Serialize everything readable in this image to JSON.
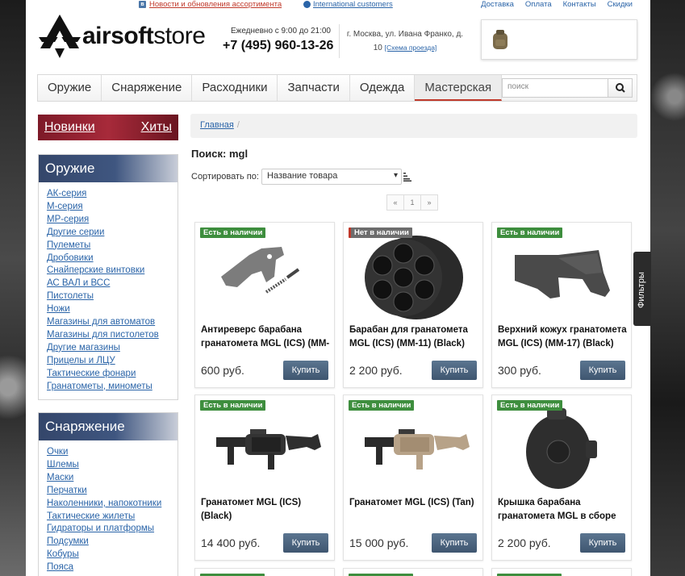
{
  "topbar": {
    "vk_icon": "vk-icon",
    "news_link": "Новости и обновления ассортимента",
    "intl_link": "International customers",
    "links": [
      "Доставка",
      "Оплата",
      "Контакты",
      "Скидки"
    ]
  },
  "header": {
    "logo_bold": "airsoft",
    "logo_light": "store",
    "hours": "Ежедневно с 9:00 до 21:00",
    "phone": "+7 (495) 960-13-26",
    "address": "г. Москва, ул. Ивана Франко, д. 10",
    "map_link": "[Схема проезда]"
  },
  "nav": {
    "items": [
      "Оружие",
      "Снаряжение",
      "Расходники",
      "Запчасти",
      "Одежда",
      "Мастерская"
    ],
    "active": "Мастерская",
    "search_placeholder": "поиск"
  },
  "sidebar": {
    "promo": {
      "new": "Новинки",
      "hits": "Хиты"
    },
    "weapons": {
      "title": "Оружие",
      "items": [
        "АК-серия",
        "М-серия",
        "МР-серия",
        "Другие серии",
        "Пулеметы",
        "Дробовики",
        "Снайперские винтовки",
        "АС ВАЛ и ВСС",
        "Пистолеты",
        "Ножи",
        "Магазины для автоматов",
        "Магазины для пистолетов",
        "Другие магазины",
        "Прицелы и ЛЦУ",
        "Тактические фонари",
        "Гранатометы, минометы"
      ]
    },
    "gear": {
      "title": "Снаряжение",
      "items": [
        "Очки",
        "Шлемы",
        "Маски",
        "Перчатки",
        "Наколенники, напокотники",
        "Тактические жилеты",
        "Гидраторы и платформы",
        "Подсумки",
        "Кобуры",
        "Пояса"
      ]
    }
  },
  "content": {
    "breadcrumb_home": "Главная",
    "breadcrumb_sep": "/",
    "title": "Поиск: mgl",
    "sort_label": "Сортировать по:",
    "sort_value": "Название товара",
    "pager": {
      "prev": "«",
      "current": "1",
      "next": "»"
    }
  },
  "products": [
    {
      "badge": "Есть в наличии",
      "in_stock": true,
      "name": "Антиреверс барабана гранатомета MGL (ICS) (MM-",
      "price": "600 руб.",
      "buy": "Купить"
    },
    {
      "badge": "Нет в наличии",
      "in_stock": false,
      "name": "Барабан для гранатомета MGL (ICS) (MM-11) (Black)",
      "price": "2 200 руб.",
      "buy": "Купить"
    },
    {
      "badge": "Есть в наличии",
      "in_stock": true,
      "name": "Верхний кожух гранатомета MGL (ICS) (MM-17) (Black)",
      "price": "300 руб.",
      "buy": "Купить"
    },
    {
      "badge": "Есть в наличии",
      "in_stock": true,
      "name": "Гранатомет MGL (ICS) (Black)",
      "price": "14 400 руб.",
      "buy": "Купить"
    },
    {
      "badge": "Есть в наличии",
      "in_stock": true,
      "name": "Гранатомет MGL (ICS) (Tan)",
      "price": "15 000 руб.",
      "buy": "Купить"
    },
    {
      "badge": "Есть в наличии",
      "in_stock": true,
      "name": "Крышка барабана гранатомета MGL в сборе",
      "price": "2 200 руб.",
      "buy": "Купить"
    }
  ],
  "filters_tab": "Фильтры",
  "colors": {
    "accent_red": "#c0392b",
    "link_blue": "#2a64a8",
    "badge_green": "#3e8e3e",
    "button_blue": "#4a6580",
    "sidebar_head": "#3f5680"
  }
}
